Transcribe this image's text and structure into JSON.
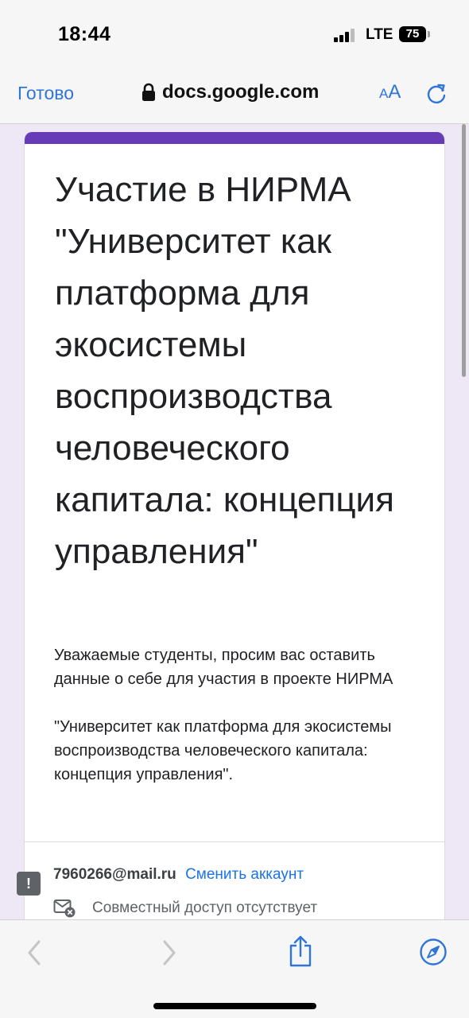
{
  "status_bar": {
    "time": "18:44",
    "network": "LTE",
    "battery": "75"
  },
  "browser": {
    "done_label": "Готово",
    "url": "docs.google.com",
    "text_size_small": "A",
    "text_size_large": "A"
  },
  "form": {
    "title": "Участие в НИРМА \"Университет как платформа для экосистемы воспроизводства человеческого капитала: концепция управления\"",
    "description": "Уважаемые студенты, просим вас оставить данные о себе для участия в проекте НИРМА\n\n\"Университет как платформа для экосистемы воспроизводства человеческого капитала: концепция управления\".",
    "account_email": "7960266@mail.ru",
    "switch_account_label": "Сменить аккаунт",
    "not_shared_text": "Совместный доступ отсутствует",
    "accent_color": "#673ab7"
  },
  "feedback": {
    "label": "!"
  },
  "toolbar": {
    "icons": [
      "back-icon",
      "forward-icon",
      "share-icon",
      "safari-compass-icon"
    ]
  }
}
